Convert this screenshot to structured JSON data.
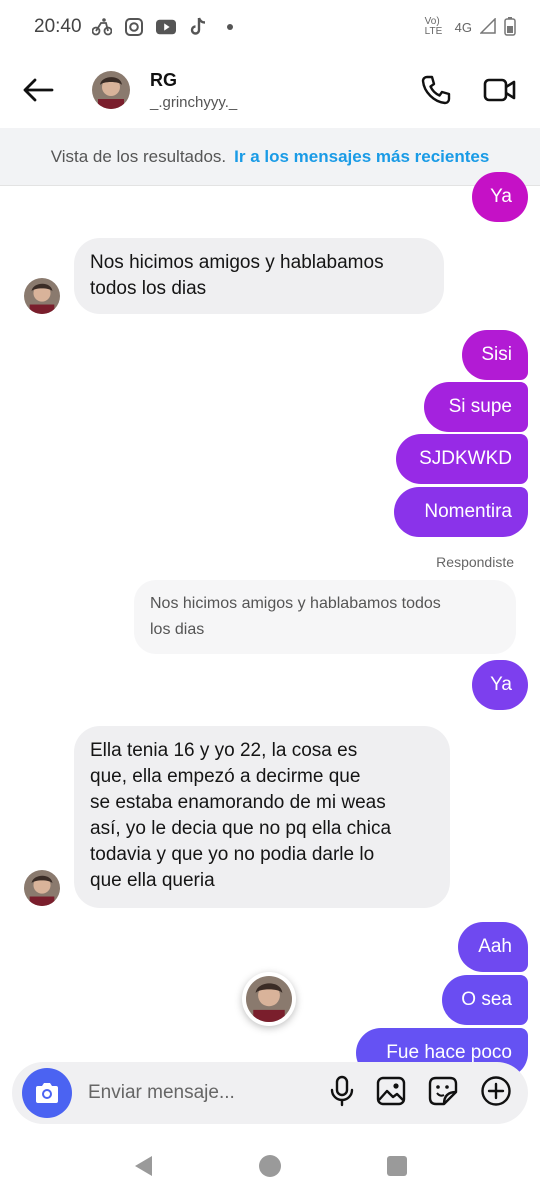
{
  "status_bar": {
    "time": "20:40",
    "network": "4G",
    "volte": "Vo) LTE"
  },
  "header": {
    "name": "RG",
    "username": "_.grinchyyy._"
  },
  "banner": {
    "text": "Vista de los resultados.",
    "link": "Ir a los mensajes más recientes"
  },
  "messages": [
    {
      "side": "out",
      "text": "Ya"
    },
    {
      "side": "in",
      "lines": [
        "Nos hicimos amigos y hablabamos",
        "todos los dias"
      ]
    },
    {
      "side": "out",
      "text": "Sisi"
    },
    {
      "side": "out",
      "text": "Si supe"
    },
    {
      "side": "out",
      "text": "SJDKWKD"
    },
    {
      "side": "out",
      "text": "Nomentira"
    },
    {
      "side": "out",
      "text": "Ya"
    },
    {
      "side": "in",
      "lines": [
        "Ella tenia 16 y yo 22, la cosa es",
        "que, ella empezó a decirme que",
        "se estaba enamorando de mi weas",
        "así, yo le decia que no pq ella chica",
        "todavia y que yo no podia darle lo",
        "que ella queria"
      ]
    },
    {
      "side": "out",
      "text": "Aah"
    },
    {
      "side": "out",
      "text": "O sea"
    },
    {
      "side": "out",
      "text": "Fue hace poco"
    }
  ],
  "reply": {
    "label": "Respondiste",
    "lines": [
      "Nos hicimos amigos y hablabamos todos",
      "los dias"
    ]
  },
  "composer": {
    "placeholder": "Enviar mensaje..."
  },
  "colors": {
    "out_top": "#c511c6",
    "out_mid": "#9b2be6",
    "out_bottom": "#6a4df2",
    "incoming": "#efeff1",
    "link": "#1a9be6",
    "camera": "#4b63f2"
  },
  "icons": [
    "back-arrow-icon",
    "phone-icon",
    "video-icon",
    "camera-icon",
    "microphone-icon",
    "gallery-icon",
    "sticker-icon",
    "add-icon",
    "nav-back-icon",
    "nav-home-icon",
    "nav-recents-icon"
  ]
}
